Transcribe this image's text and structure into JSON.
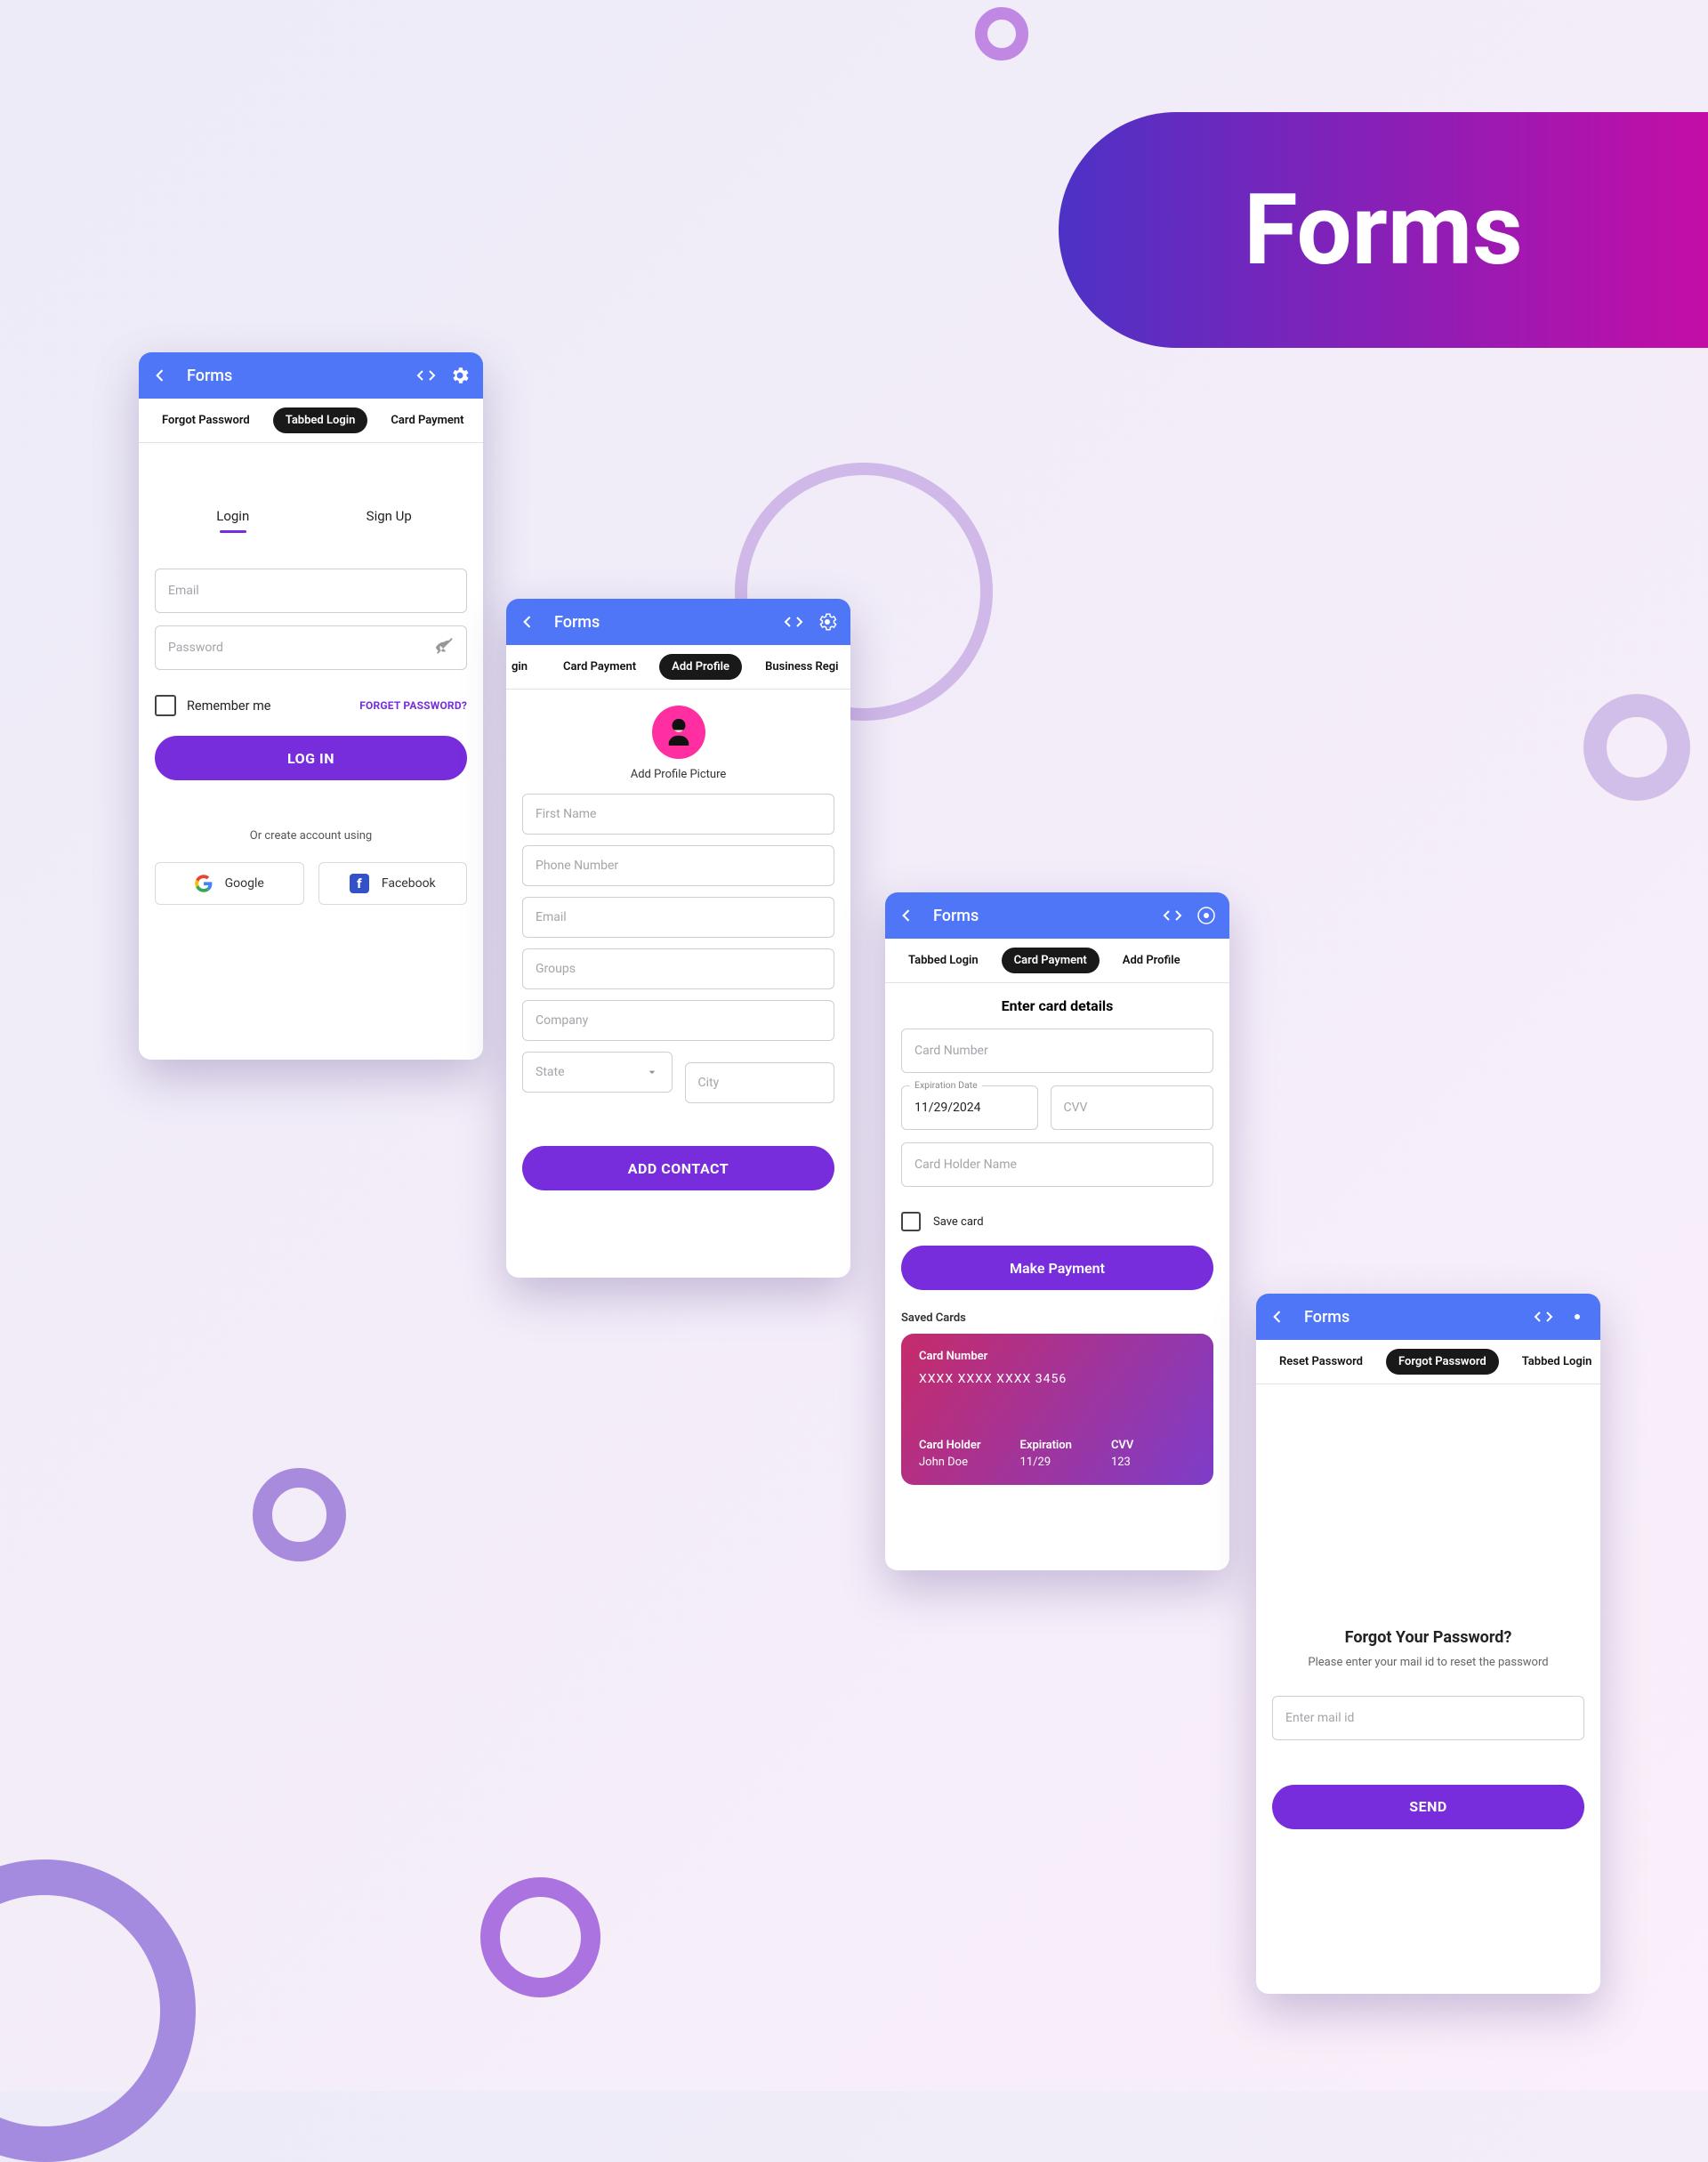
{
  "header_title": "Forms",
  "appbar_title": "Forms",
  "screen1": {
    "chips": [
      "Forgot Password",
      "Tabbed Login",
      "Card Payment"
    ],
    "active_chip": 1,
    "tabs": [
      "Login",
      "Sign Up"
    ],
    "active_tab": 0,
    "email_ph": "Email",
    "password_ph": "Password",
    "remember_label": "Remember me",
    "forget_link": "FORGET PASSWORD?",
    "login_btn": "LOG IN",
    "or_create": "Or create account using",
    "google": "Google",
    "facebook": "Facebook"
  },
  "screen2": {
    "chips_left": "gin",
    "chips": [
      "Card Payment",
      "Add Profile",
      "Business Regi"
    ],
    "active_chip": 1,
    "avatar_label": "Add Profile Picture",
    "fields": {
      "first_name": "First Name",
      "phone": "Phone Number",
      "email": "Email",
      "groups": "Groups",
      "company": "Company",
      "state": "State",
      "city": "City"
    },
    "submit": "ADD CONTACT"
  },
  "screen3": {
    "chips": [
      "Tabbed Login",
      "Card Payment",
      "Add Profile"
    ],
    "active_chip": 1,
    "title": "Enter card details",
    "card_number_ph": "Card Number",
    "exp_label": "Expiration Date",
    "exp_value": "11/29/2024",
    "cvv_ph": "CVV",
    "holder_ph": "Card Holder Name",
    "save_label": "Save card",
    "pay_btn": "Make Payment",
    "saved_header": "Saved Cards",
    "saved_card": {
      "num_label": "Card Number",
      "num": "XXXX XXXX XXXX 3456",
      "holder_label": "Card Holder",
      "holder": "John Doe",
      "exp_label": "Expiration",
      "exp": "11/29",
      "cvv_label": "CVV",
      "cvv": "123"
    }
  },
  "screen4": {
    "chips": [
      "Reset Password",
      "Forgot Password",
      "Tabbed Login"
    ],
    "active_chip": 1,
    "heading": "Forgot Your Password?",
    "sub": "Please enter your mail id to reset the password",
    "email_ph": "Enter mail id",
    "send_btn": "SEND"
  }
}
